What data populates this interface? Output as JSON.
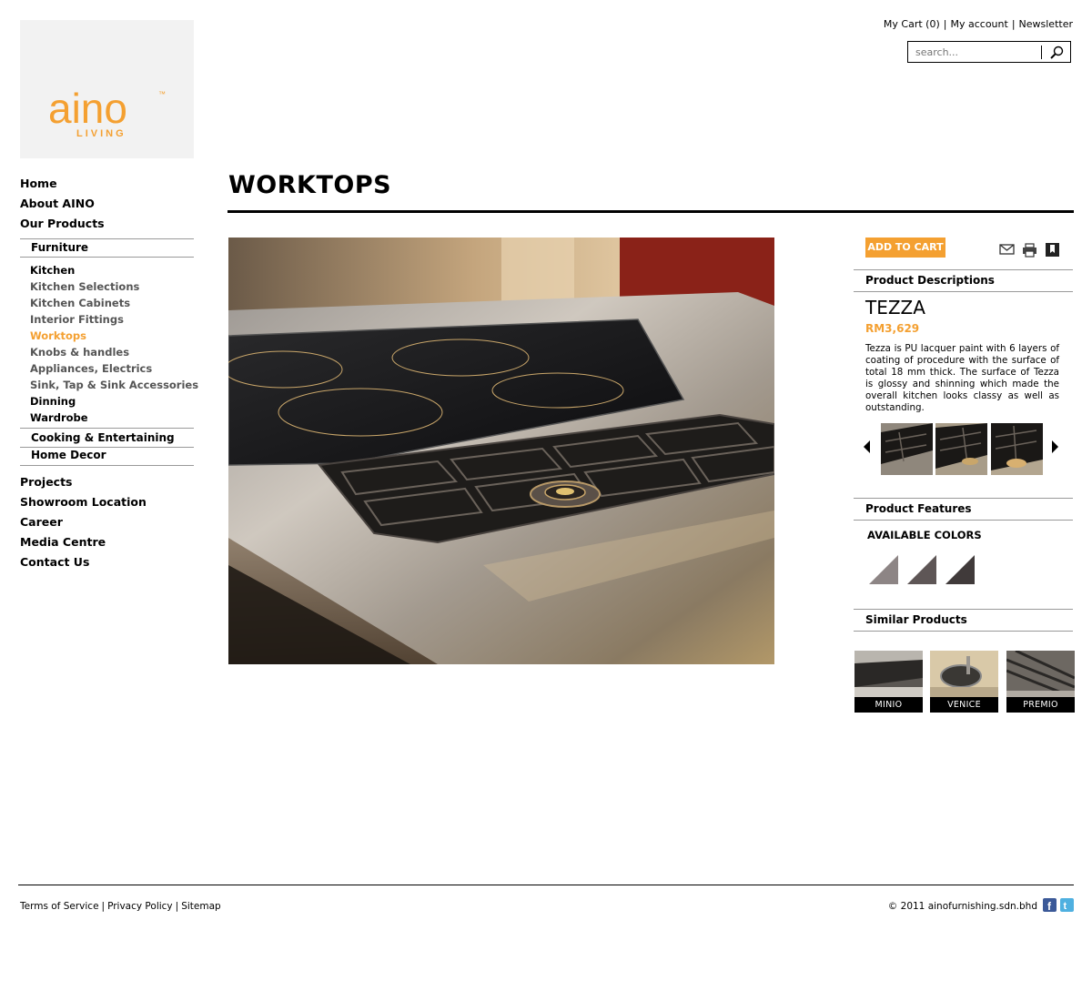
{
  "brand": {
    "logo_text": "aino",
    "logo_sub": "LIVING",
    "logo_mark": "™",
    "accent": "#f4a031"
  },
  "header": {
    "links": [
      "My Cart (0)",
      "My account",
      "Newsletter"
    ],
    "search_placeholder": "search...",
    "search_icon": "magnifier-icon"
  },
  "nav": {
    "main_top": [
      "Home",
      "About AINO",
      "Our Products"
    ],
    "categories": {
      "furniture": "Furniture",
      "cooking": "Cooking & Entertaining",
      "decor": "Home Decor"
    },
    "sub_items": [
      "Kitchen",
      "Kitchen Selections",
      "Kitchen Cabinets",
      "Interior Fittings",
      "Worktops",
      "Knobs & handles",
      "Appliances, Electrics",
      "Sink, Tap & Sink Accessories",
      "Dinning",
      "Wardrobe"
    ],
    "active_item": "Worktops",
    "main_bottom": [
      "Projects",
      "Showroom Location",
      "Career",
      "Media Centre",
      "Contact Us"
    ]
  },
  "page": {
    "title": "WORKTOPS"
  },
  "product": {
    "add_to_cart": "ADD TO CART",
    "action_icons": [
      "mail-icon",
      "print-icon",
      "bookmark-icon"
    ],
    "descriptions_title": "Product Descriptions",
    "name": "TEZZA",
    "price": "RM3,629",
    "description": "Tezza is PU lacquer paint with 6 layers of coating of procedure with the surface of total 18 mm thick. The surface of Tezza is glossy and shinning which made the overall kitchen looks classy as well as outstanding.",
    "features_title": "Product Features",
    "colors_title": "AVAILABLE COLORS",
    "colors": [
      "#8d8585",
      "#5e5656",
      "#403a3a"
    ],
    "similar_title": "Similar Products",
    "similar": [
      "MINIO",
      "VENICE",
      "PREMIO"
    ]
  },
  "footer": {
    "links": [
      "Terms of Service",
      "Privacy Policy",
      "Sitemap"
    ],
    "copyright": "© 2011 ainofurnishing.sdn.bhd",
    "social": [
      "facebook-icon",
      "twitter-icon"
    ]
  }
}
